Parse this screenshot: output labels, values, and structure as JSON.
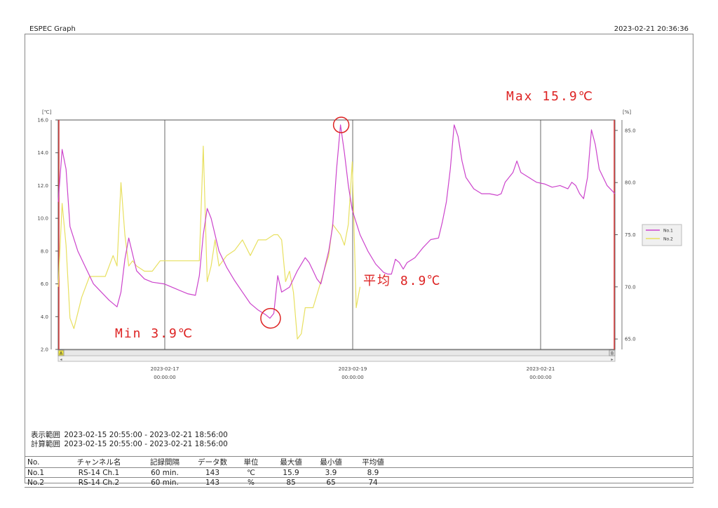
{
  "header": {
    "title": "ESPEC Graph",
    "printed": "2023-02-21 20:36:36"
  },
  "chart_data": {
    "type": "line",
    "y_left": {
      "unit": "[℃]",
      "ylim": [
        2,
        16
      ],
      "ticks": [
        "2.0",
        "4.0",
        "6.0",
        "8.0",
        "10.0",
        "12.0",
        "14.0",
        "16.0"
      ]
    },
    "y_right": {
      "unit": "[%]",
      "ylim": [
        64,
        86
      ],
      "ticks": [
        "65.0",
        "70.0",
        "75.0",
        "80.0",
        "85.0"
      ]
    },
    "x_ticks": [
      {
        "date": "2023-02-17",
        "time": "00:00:00",
        "hours": 51.08
      },
      {
        "date": "2023-02-19",
        "time": "00:00:00",
        "hours": 99.08
      },
      {
        "date": "2023-02-21",
        "time": "00:00:00",
        "hours": 147.08
      }
    ],
    "x_range_hours": [
      0,
      142
    ],
    "scroll_markers": [
      "A",
      "B"
    ],
    "legend": {
      "placement": "right",
      "entries": [
        "No.1",
        "No.2"
      ]
    },
    "series": [
      {
        "name": "No.1",
        "unit": "℃",
        "color": "#cc44cc",
        "points": [
          [
            0,
            11
          ],
          [
            1,
            14.2
          ],
          [
            2,
            13
          ],
          [
            3,
            9.5
          ],
          [
            5,
            8
          ],
          [
            7,
            7
          ],
          [
            9,
            6
          ],
          [
            11,
            5.5
          ],
          [
            13,
            5
          ],
          [
            15,
            4.6
          ],
          [
            16,
            5.5
          ],
          [
            17,
            7.5
          ],
          [
            18,
            8.8
          ],
          [
            19,
            7.8
          ],
          [
            20,
            6.8
          ],
          [
            22,
            6.3
          ],
          [
            24,
            6.1
          ],
          [
            27,
            6
          ],
          [
            30,
            5.7
          ],
          [
            33,
            5.4
          ],
          [
            35,
            5.3
          ],
          [
            36,
            6.5
          ],
          [
            37,
            9
          ],
          [
            38,
            10.6
          ],
          [
            39,
            10
          ],
          [
            40,
            9
          ],
          [
            41,
            8
          ],
          [
            43,
            7
          ],
          [
            45,
            6.2
          ],
          [
            47,
            5.5
          ],
          [
            49,
            4.8
          ],
          [
            51,
            4.4
          ],
          [
            53,
            4.1
          ],
          [
            54,
            3.9
          ],
          [
            55,
            4.2
          ],
          [
            56,
            6.5
          ],
          [
            57,
            5.5
          ],
          [
            59,
            5.8
          ],
          [
            61,
            6.8
          ],
          [
            63,
            7.6
          ],
          [
            64,
            7.3
          ],
          [
            65,
            6.8
          ],
          [
            66,
            6.3
          ],
          [
            67,
            6
          ],
          [
            68,
            7
          ],
          [
            69,
            8
          ],
          [
            70,
            9.5
          ],
          [
            71,
            13
          ],
          [
            72,
            15.7
          ],
          [
            73,
            14
          ],
          [
            74,
            12
          ],
          [
            75,
            10.5
          ],
          [
            77,
            9
          ],
          [
            79,
            8
          ],
          [
            81,
            7.2
          ],
          [
            83,
            6.7
          ],
          [
            84,
            6.6
          ],
          [
            85,
            6.6
          ],
          [
            86,
            7.5
          ],
          [
            87,
            7.3
          ],
          [
            88,
            6.9
          ],
          [
            89,
            7.3
          ],
          [
            91,
            7.6
          ],
          [
            93,
            8.2
          ],
          [
            95,
            8.7
          ],
          [
            97,
            8.8
          ],
          [
            98,
            9.8
          ],
          [
            99,
            11
          ],
          [
            100,
            13
          ],
          [
            101,
            15.7
          ],
          [
            102,
            15
          ],
          [
            103,
            13.5
          ],
          [
            104,
            12.5
          ],
          [
            106,
            11.8
          ],
          [
            108,
            11.5
          ],
          [
            110,
            11.5
          ],
          [
            112,
            11.4
          ],
          [
            113,
            11.5
          ],
          [
            114,
            12.2
          ],
          [
            115,
            12.5
          ],
          [
            116,
            12.8
          ],
          [
            117,
            13.5
          ],
          [
            118,
            12.8
          ],
          [
            120,
            12.5
          ],
          [
            122,
            12.2
          ],
          [
            124,
            12.1
          ],
          [
            126,
            11.9
          ],
          [
            128,
            12
          ],
          [
            130,
            11.8
          ],
          [
            131,
            12.2
          ],
          [
            132,
            12
          ],
          [
            133,
            11.5
          ],
          [
            134,
            11.2
          ],
          [
            135,
            12.5
          ],
          [
            136,
            15.4
          ],
          [
            137,
            14.5
          ],
          [
            138,
            13
          ],
          [
            140,
            12
          ],
          [
            142,
            11.5
          ]
        ]
      },
      {
        "name": "No.2",
        "unit": "%",
        "color": "#e8e060",
        "points": [
          [
            0,
            70
          ],
          [
            1,
            78
          ],
          [
            2,
            74
          ],
          [
            3,
            67
          ],
          [
            4,
            66
          ],
          [
            6,
            69
          ],
          [
            8,
            71
          ],
          [
            10,
            71
          ],
          [
            12,
            71
          ],
          [
            14,
            73
          ],
          [
            15,
            72
          ],
          [
            16,
            80
          ],
          [
            17,
            75
          ],
          [
            18,
            72
          ],
          [
            19,
            72.5
          ],
          [
            20,
            72
          ],
          [
            22,
            71.5
          ],
          [
            24,
            71.5
          ],
          [
            26,
            72.5
          ],
          [
            28,
            72.5
          ],
          [
            30,
            72.5
          ],
          [
            32,
            72.5
          ],
          [
            34,
            72.5
          ],
          [
            36,
            72.5
          ],
          [
            37,
            83.5
          ],
          [
            38,
            70.5
          ],
          [
            39,
            72
          ],
          [
            40,
            74.5
          ],
          [
            41,
            72
          ],
          [
            43,
            73
          ],
          [
            45,
            73.5
          ],
          [
            47,
            74.5
          ],
          [
            49,
            73
          ],
          [
            51,
            74.5
          ],
          [
            53,
            74.5
          ],
          [
            55,
            75
          ],
          [
            56,
            75
          ],
          [
            57,
            74.5
          ],
          [
            58,
            70.5
          ],
          [
            59,
            71.5
          ],
          [
            60,
            69.5
          ],
          [
            61,
            65
          ],
          [
            62,
            65.5
          ],
          [
            63,
            68
          ],
          [
            65,
            68
          ],
          [
            67,
            70.5
          ],
          [
            69,
            73
          ],
          [
            70,
            76
          ],
          [
            71,
            75.5
          ],
          [
            72,
            75
          ],
          [
            73,
            74
          ],
          [
            74,
            76
          ],
          [
            75,
            82
          ],
          [
            76,
            68
          ],
          [
            77,
            70
          ]
        ]
      }
    ],
    "annotations": {
      "max": "Max 15.9℃",
      "min": "Min 3.9℃",
      "avg": "平均 8.9℃"
    }
  },
  "info": {
    "display_label": "表示範囲",
    "display_range": "2023-02-15 20:55:00 - 2023-02-21 18:56:00",
    "calc_label": "計算範囲",
    "calc_range": "2023-02-15 20:55:00 - 2023-02-21 18:56:00"
  },
  "table": {
    "headers": [
      "No.",
      "チャンネル名",
      "記録間隔",
      "データ数",
      "単位",
      "最大値",
      "最小値",
      "平均値"
    ],
    "rows": [
      [
        "No.1",
        "RS-14 Ch.1",
        "60 min.",
        "143",
        "℃",
        "15.9",
        "3.9",
        "8.9"
      ],
      [
        "No.2",
        "RS-14 Ch.2",
        "60 min.",
        "143",
        "%",
        "85",
        "65",
        "74"
      ]
    ]
  }
}
